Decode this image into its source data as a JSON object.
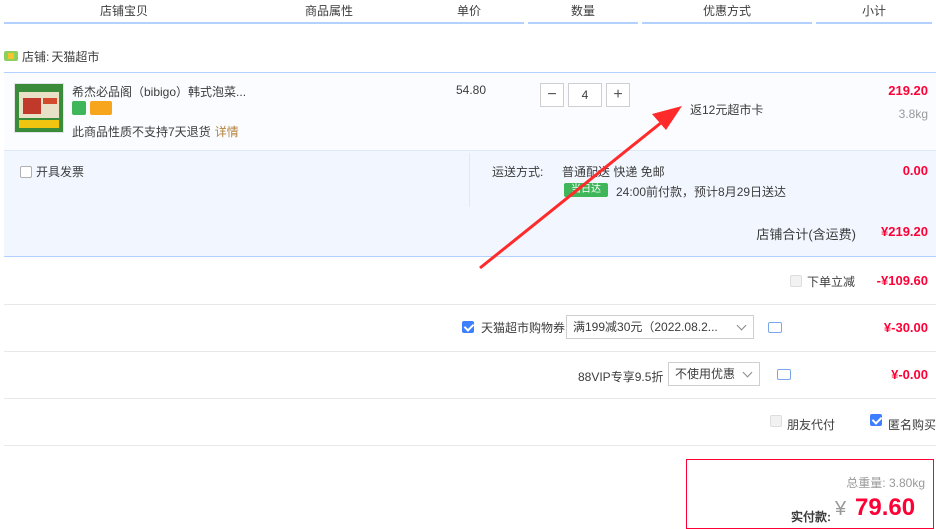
{
  "header": {
    "cols": [
      "店铺宝贝",
      "商品属性",
      "单价",
      "数量",
      "优惠方式",
      "小计"
    ]
  },
  "shop": {
    "label": "店铺:",
    "name": "天猫超市"
  },
  "item": {
    "title": "希杰必品阁（bibigo）韩式泡菜...",
    "no_return": "此商品性质不支持7天退货",
    "details_link": "详情",
    "unit_price": "54.80",
    "quantity": "4",
    "promo": "返12元超市卡",
    "subtotal": "219.20",
    "weight": "3.8kg"
  },
  "invoice": {
    "label": "开具发票"
  },
  "shipping": {
    "label": "运送方式:",
    "method": "普通配送 快递 免邮",
    "badge": "当日达",
    "eta": "24:00前付款，预计8月29日送达",
    "cost": "0.00"
  },
  "shop_total": {
    "label": "店铺合计(含运费)",
    "value": "¥219.20"
  },
  "discounts": {
    "instant": {
      "label": "下单立减",
      "value": "-¥109.60"
    },
    "coupon": {
      "label": "天猫超市购物券",
      "selected": "满199减30元（2022.08.2...",
      "value": "¥-30.00"
    },
    "vip": {
      "label": "88VIP专享9.5折",
      "selected": "不使用优惠",
      "value": "¥-0.00"
    }
  },
  "options": {
    "friend_pay": "朋友代付",
    "anonymous": "匿名购买"
  },
  "total": {
    "weight_label": "总重量:",
    "weight": "3.80kg",
    "pay_label": "实付款:",
    "currency": "¥",
    "amount": "79.60"
  },
  "colors": {
    "accent": "#ff0036",
    "border_blue": "#b2d1ff",
    "arrow": "#ff2a2a"
  }
}
